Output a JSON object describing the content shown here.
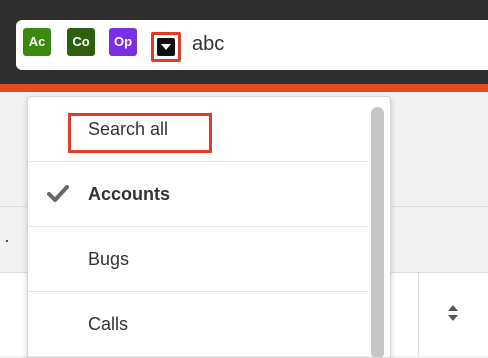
{
  "search_bar": {
    "modules": [
      {
        "abbr": "Ac",
        "color": "#3a8a0f"
      },
      {
        "abbr": "Co",
        "color": "#2e5f10"
      },
      {
        "abbr": "Op",
        "color": "#7a2ee6"
      }
    ],
    "toggle_icon": "caret-down-icon",
    "query": "abc"
  },
  "dropdown": {
    "items": [
      {
        "label": "Search all",
        "checked": false,
        "bold": false
      },
      {
        "label": "Accounts",
        "checked": true,
        "bold": true
      },
      {
        "label": "Bugs",
        "checked": false,
        "bold": false
      },
      {
        "label": "Calls",
        "checked": false,
        "bold": false
      }
    ]
  },
  "colors": {
    "header_bg": "#2e2e2e",
    "accent_orange": "#e24b1d",
    "highlight_red": "#e23b2a"
  }
}
